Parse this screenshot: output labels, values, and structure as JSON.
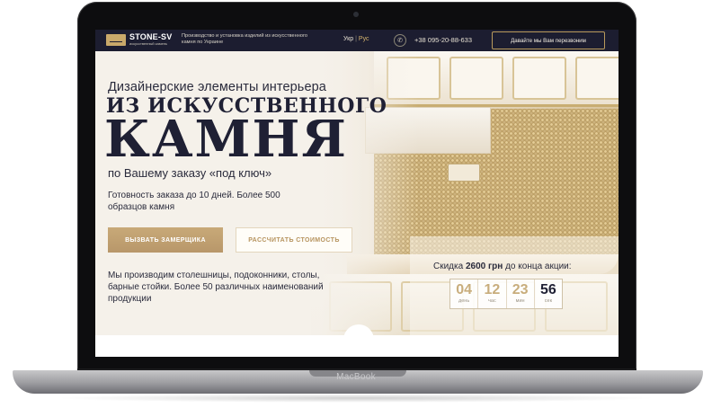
{
  "device_label": "MacBook",
  "header": {
    "logo_title": "STONE-SV",
    "logo_subtitle": "искусственный камень",
    "tagline": "Производство и установка изделий из искусственного камня по Украине",
    "lang_ukr": "Укр",
    "lang_sep": "|",
    "lang_rus": "Рус",
    "phone": "+38 095-20-88-633",
    "callback_label": "Давайте мы Вам перезвоним"
  },
  "hero": {
    "line1": "Дизайнерские элементы интерьера",
    "line2": "ИЗ ИСКУССТВЕННОГО",
    "line3": "КАМНЯ",
    "line4": "по Вашему заказу «под ключ»",
    "features": "Готовность заказа до 10 дней. Более 500 образцов камня",
    "btn_measure": "ВЫЗВАТЬ ЗАМЕРЩИКА",
    "btn_calc": "РАССЧИТАТЬ СТОИМОСТЬ",
    "description": "Мы производим столешницы, подоконники, столы, барные стойки. Более 50 различных наименований продукции"
  },
  "promo": {
    "prefix": "Скидка",
    "amount": "2600 грн",
    "suffix": "до конца акции:"
  },
  "timer": {
    "days": "04",
    "days_label": "день",
    "hours": "12",
    "hours_label": "час",
    "minutes": "23",
    "minutes_label": "мин",
    "seconds": "56",
    "seconds_label": "сек"
  },
  "colors": {
    "header_bg": "#1c1d30",
    "accent_gold": "#c8a978",
    "text_dark": "#1f2034"
  }
}
